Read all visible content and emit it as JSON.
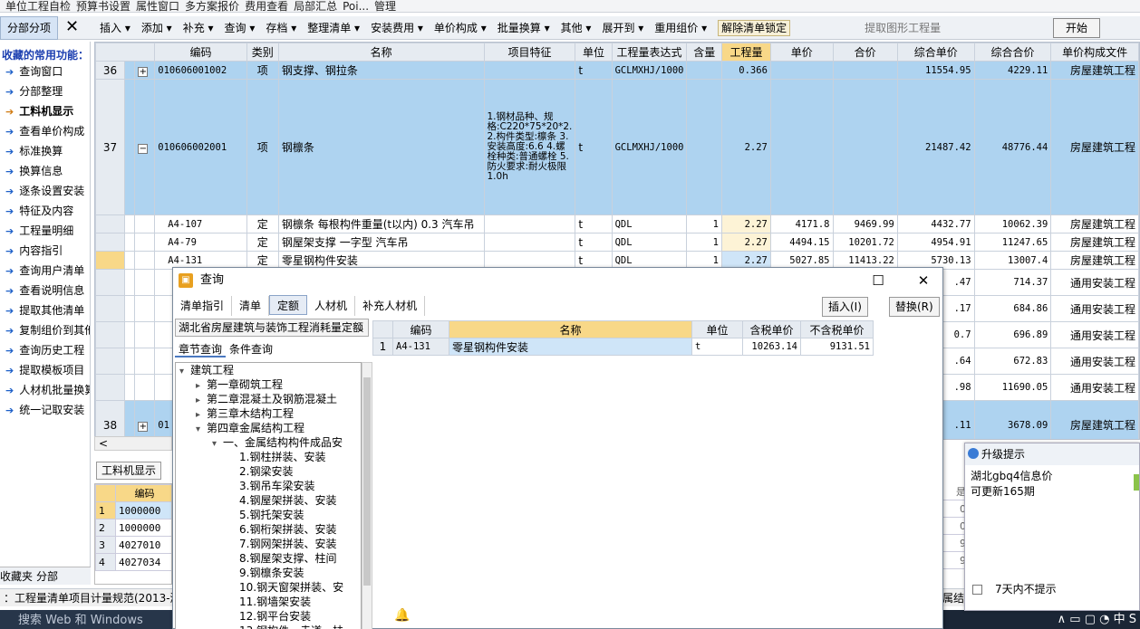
{
  "topbar": {
    "items": [
      "单位工程自检",
      "预算书设置",
      "属性窗口",
      "多方案报价",
      "费用查看",
      "局部汇总",
      "Poi...",
      "管理"
    ]
  },
  "toolbar": {
    "tab_label": "分部分项",
    "close_label": "✕",
    "items": [
      "插入 ▾",
      "添加 ▾",
      "补充 ▾",
      "查询 ▾",
      "存档 ▾",
      "整理清单 ▾",
      "安装费用 ▾",
      "单价构成 ▾",
      "批量换算 ▾",
      "其他 ▾",
      "展开到 ▾",
      "重用组价 ▾"
    ],
    "lock_label": "解除清单锁定",
    "extract_label": "提取图形工程量",
    "start_label": "开始"
  },
  "sidebar": {
    "title": "收藏的常用功能：",
    "items": [
      "查询窗口",
      "分部整理",
      "工料机显示",
      "查看单价构成",
      "标准换算",
      "换算信息",
      "逐条设置安装",
      "特征及内容",
      "工程量明细",
      "内容指引",
      "查询用户清单",
      "查看说明信息",
      "提取其他清单",
      "复制组价到其他",
      "查询历史工程",
      "提取模板项目",
      "人材机批量换算",
      "统一记取安装"
    ],
    "current_index": 2,
    "tabs": [
      "收藏夹",
      "分部"
    ]
  },
  "grid": {
    "headers": [
      "编码",
      "类别",
      "名称",
      "项目特征",
      "单位",
      "工程量表达式",
      "含量",
      "工程量",
      "单价",
      "合价",
      "综合单价",
      "综合合价",
      "单价构成文件"
    ],
    "rows": [
      {
        "rn": "36",
        "pm": "+",
        "code": "010606001002",
        "type": "项",
        "name": "钢支撑、钢拉条",
        "feat": "",
        "unit": "t",
        "expr": "GCLMXHJ/1000",
        "qty_ratio": "",
        "qty": "0.366",
        "price": "",
        "total": "",
        "cprice": "11554.95",
        "ctotal": "4229.11",
        "file": "房屋建筑工程"
      },
      {
        "rn": "37",
        "pm": "−",
        "code": "010606002001",
        "type": "项",
        "name": "钢檩条",
        "feat": "1.钢材品种、规格:C220*75*20*2.\n2.构件类型:檩条\n3.安装高度:6.6\n4.螺栓种类:普通螺栓\n5.防火要求:耐火极限1.0h",
        "unit": "t",
        "expr": "GCLMXHJ/1000",
        "qty_ratio": "",
        "qty": "2.27",
        "price": "",
        "total": "",
        "cprice": "21487.42",
        "ctotal": "48776.44",
        "file": "房屋建筑工程"
      },
      {
        "rn": "",
        "pm": "",
        "code": "A4-107",
        "type": "定",
        "name": "钢檩条 每根构件重量(t以内) 0.3 汽车吊",
        "feat": "",
        "unit": "t",
        "expr": "QDL",
        "qty_ratio": "1",
        "qty": "2.27",
        "price": "4171.8",
        "total": "9469.99",
        "cprice": "4432.77",
        "ctotal": "10062.39",
        "file": "房屋建筑工程"
      },
      {
        "rn": "",
        "pm": "",
        "code": "A4-79",
        "type": "定",
        "name": "钢屋架支撑 一字型 汽车吊",
        "feat": "",
        "unit": "t",
        "expr": "QDL",
        "qty_ratio": "1",
        "qty": "2.27",
        "price": "4494.15",
        "total": "10201.72",
        "cprice": "4954.91",
        "ctotal": "11247.65",
        "file": "房屋建筑工程"
      },
      {
        "rn": "",
        "pm": "",
        "code": "A4-131",
        "type": "定",
        "name": "零星钢构件安装",
        "feat": "",
        "unit": "t",
        "expr": "QDL",
        "qty_ratio": "1",
        "qty": "2.27",
        "price": "5027.85",
        "total": "11413.22",
        "cprice": "5730.13",
        "ctotal": "13007.4",
        "file": "房屋建筑工程"
      },
      {
        "rn": "",
        "pm": "",
        "code": "",
        "type": "",
        "name": "",
        "feat": "",
        "unit": "",
        "expr": "",
        "qty_ratio": "",
        "qty": "",
        "price": "",
        "total": "",
        "cprice": ".47",
        "ctotal": "714.37",
        "file": "通用安装工程"
      },
      {
        "rn": "",
        "pm": "",
        "code": "",
        "type": "",
        "name": "",
        "feat": "",
        "unit": "",
        "expr": "",
        "qty_ratio": "",
        "qty": "",
        "price": "",
        "total": "",
        "cprice": ".17",
        "ctotal": "684.86",
        "file": "通用安装工程"
      },
      {
        "rn": "",
        "pm": "",
        "code": "",
        "type": "",
        "name": "",
        "feat": "",
        "unit": "",
        "expr": "",
        "qty_ratio": "",
        "qty": "",
        "price": "",
        "total": "",
        "cprice": "0.7",
        "ctotal": "696.89",
        "file": "通用安装工程"
      },
      {
        "rn": "",
        "pm": "",
        "code": "",
        "type": "",
        "name": "",
        "feat": "",
        "unit": "",
        "expr": "",
        "qty_ratio": "",
        "qty": "",
        "price": "",
        "total": "",
        "cprice": ".64",
        "ctotal": "672.83",
        "file": "通用安装工程"
      },
      {
        "rn": "",
        "pm": "",
        "code": "",
        "type": "",
        "name": "",
        "feat": "",
        "unit": "",
        "expr": "",
        "qty_ratio": "",
        "qty": "",
        "price": "",
        "total": "",
        "cprice": ".98",
        "ctotal": "11690.05",
        "file": "通用安装工程"
      },
      {
        "rn": "38",
        "pm": "+",
        "code": "01",
        "type": "",
        "name": "",
        "feat": "",
        "unit": "",
        "expr": "",
        "qty_ratio": "",
        "qty": "",
        "price": "",
        "total": "",
        "cprice": ".11",
        "ctotal": "3678.09",
        "file": "房屋建筑工程"
      }
    ]
  },
  "lower": {
    "tab_label": "工料机显示",
    "header": "编码",
    "rows": [
      {
        "n": "1",
        "code": "1000000"
      },
      {
        "n": "2",
        "code": "1000000"
      },
      {
        "n": "3",
        "code": "4027010"
      },
      {
        "n": "4",
        "code": "4027034"
      }
    ],
    "right_frag": [
      "是",
      "0",
      "0",
      "9",
      "9"
    ]
  },
  "status": {
    "text": "：工程量清单项目计量规范(2013-湖",
    "right_frag": "属结"
  },
  "taskbar": {
    "search": "搜索 Web 和 Windows",
    "sys": "∧ ▭ ▢ ◔ 中 S"
  },
  "dialog": {
    "title": "查询",
    "tabs": [
      "清单指引",
      "清单",
      "定额",
      "人材机",
      "补充人材机"
    ],
    "active_tab": 2,
    "insert_label": "插入(I)",
    "replace_label": "替换(R)",
    "library": "湖北省房屋建筑与装饰工程消耗量定额",
    "subtabs": [
      "章节查询",
      "条件查询"
    ],
    "tree": [
      {
        "lvl": 0,
        "tw": "▾",
        "t": "建筑工程"
      },
      {
        "lvl": 1,
        "tw": "▸",
        "t": "第一章砌筑工程"
      },
      {
        "lvl": 1,
        "tw": "▸",
        "t": "第二章混凝土及钢筋混凝土"
      },
      {
        "lvl": 1,
        "tw": "▸",
        "t": "第三章木结构工程"
      },
      {
        "lvl": 1,
        "tw": "▾",
        "t": "第四章金属结构工程"
      },
      {
        "lvl": 2,
        "tw": "▾",
        "t": "一、金属结构构件成品安"
      },
      {
        "lvl": 3,
        "tw": "",
        "t": "1.钢柱拼装、安装"
      },
      {
        "lvl": 3,
        "tw": "",
        "t": "2.钢梁安装"
      },
      {
        "lvl": 3,
        "tw": "",
        "t": "3.钢吊车梁安装"
      },
      {
        "lvl": 3,
        "tw": "",
        "t": "4.钢屋架拼装、安装"
      },
      {
        "lvl": 3,
        "tw": "",
        "t": "5.钢托架安装"
      },
      {
        "lvl": 3,
        "tw": "",
        "t": "6.钢桁架拼装、安装"
      },
      {
        "lvl": 3,
        "tw": "",
        "t": "7.钢网架拼装、安装"
      },
      {
        "lvl": 3,
        "tw": "",
        "t": "8.钢屋架支撑、柱间"
      },
      {
        "lvl": 3,
        "tw": "",
        "t": "9.钢檩条安装"
      },
      {
        "lvl": 3,
        "tw": "",
        "t": "10.钢天窗架拼装、安"
      },
      {
        "lvl": 3,
        "tw": "",
        "t": "11.钢墙架安装"
      },
      {
        "lvl": 3,
        "tw": "",
        "t": "12.钢平台安装"
      },
      {
        "lvl": 3,
        "tw": "",
        "t": "13.钢构件、走道、扶"
      }
    ],
    "grid_headers": [
      "编码",
      "名称",
      "单位",
      "含税单价",
      "不含税单价"
    ],
    "grid_rows": [
      {
        "n": "1",
        "code": "A4-131",
        "name": "零星钢构件安装",
        "unit": "t",
        "tax": "10263.14",
        "notax": "9131.51"
      }
    ]
  },
  "popup": {
    "title": "升级提示",
    "line1": "湖北gbq4信息价",
    "line2": "可更新165期",
    "checkbox_label": "7天内不提示"
  }
}
